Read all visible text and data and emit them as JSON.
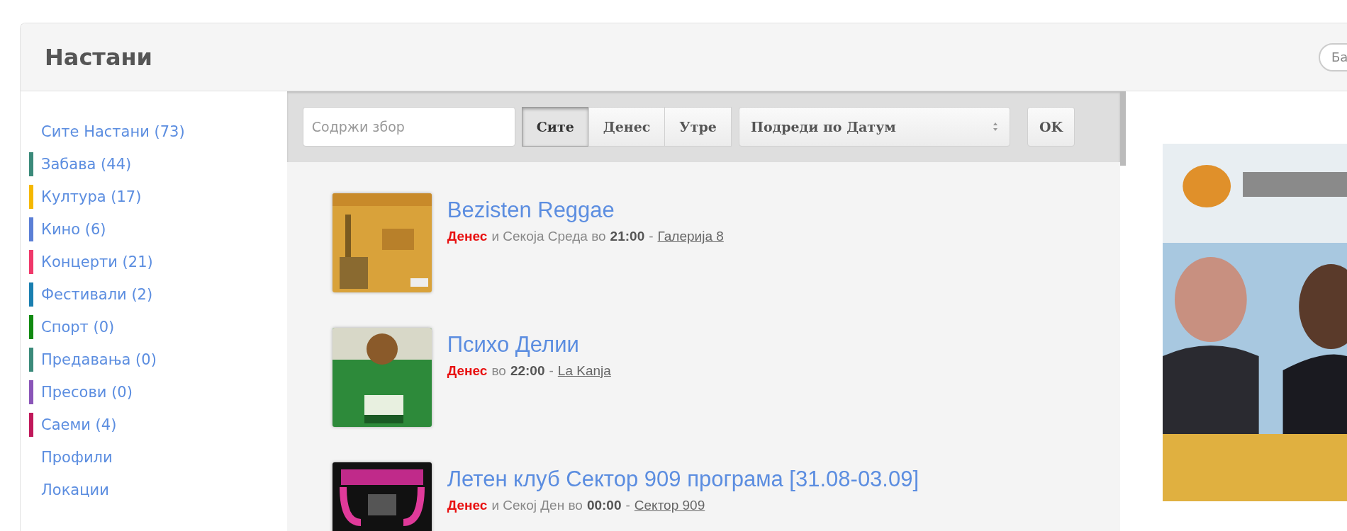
{
  "header": {
    "title": "Настани",
    "search": {
      "placeholder": "Ба"
    }
  },
  "sidebar": {
    "items": [
      {
        "label": "Сите Настани (73)"
      },
      {
        "label": "Забава (44)",
        "color": "#3b8a7a"
      },
      {
        "label": "Култура (17)",
        "color": "#f5b800"
      },
      {
        "label": "Кино (6)",
        "color": "#5b7fd6"
      },
      {
        "label": "Концерти (21)",
        "color": "#f0386a"
      },
      {
        "label": "Фестивали (2)",
        "color": "#1a7fb0"
      },
      {
        "label": "Спорт (0)",
        "color": "#118a11"
      },
      {
        "label": "Предавања (0)",
        "color": "#3b8a7a"
      },
      {
        "label": "Пресови (0)",
        "color": "#8a55b8"
      },
      {
        "label": "Саеми (4)",
        "color": "#c0185a"
      },
      {
        "label": "Профили"
      },
      {
        "label": "Локации"
      }
    ]
  },
  "toolbar": {
    "search": {
      "placeholder": "Содржи збор"
    },
    "filters": [
      {
        "label": "Сите",
        "selected": true
      },
      {
        "label": "Денес",
        "selected": false
      },
      {
        "label": "Утре",
        "selected": false
      }
    ],
    "sort": {
      "value": "Подреди по Датум"
    },
    "ok": "OK"
  },
  "events": [
    {
      "title": "Bezisten Reggae",
      "day": "Денес",
      "recurrence": "и Секоја Среда во",
      "time": "21:00",
      "separator": "-",
      "venue": "Галерија 8"
    },
    {
      "title": "Психо Делии",
      "day": "Денес",
      "recurrence": "во",
      "time": "22:00",
      "separator": "-",
      "venue": "La Kanja"
    },
    {
      "title": "Летен клуб Сектор 909 програма [31.08-03.09]",
      "day": "Денес",
      "recurrence": "и Секој Ден во",
      "time": "00:00",
      "separator": "-",
      "venue": "Сектор 909"
    }
  ]
}
